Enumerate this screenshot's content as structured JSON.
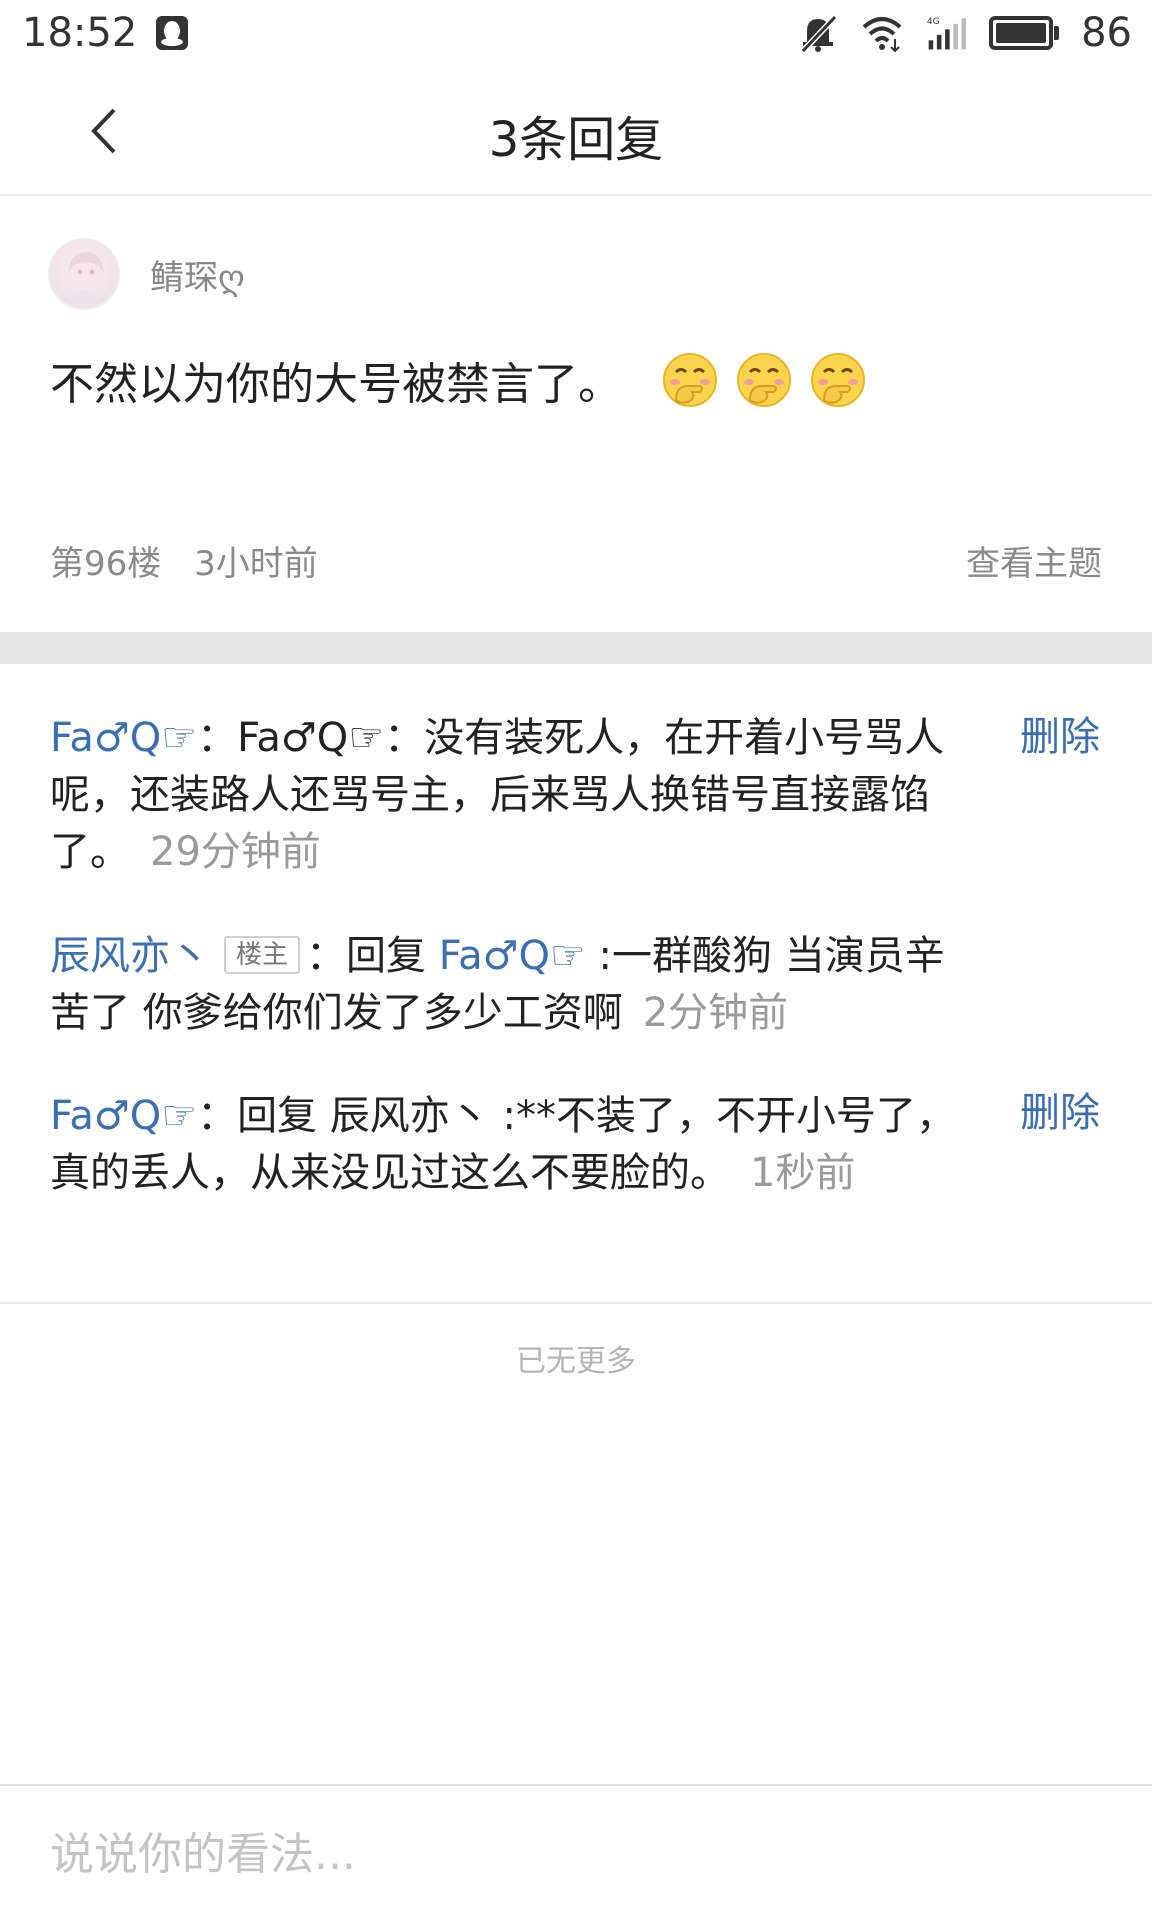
{
  "status_bar": {
    "time": "18:52",
    "battery": "86",
    "icons": [
      "qq-icon",
      "mute-icon",
      "wifi-icon",
      "signal-4g-icon",
      "battery-icon"
    ]
  },
  "header": {
    "title": "3条回复"
  },
  "post": {
    "author": "鲭琛ღ",
    "text": "不然以为你的大号被禁言了。",
    "emoji_count": 3,
    "floor": "第96楼",
    "time": "3小时前",
    "view_topic": "查看主题"
  },
  "replies": [
    {
      "user": "Fa♂Q☞",
      "sep": "：",
      "body": "Fa♂Q☞：没有装死人，在开着小号骂人呢，还装路人还骂号主，后来骂人换错号直接露馅了。",
      "time": "29分钟前",
      "delete": "删除"
    },
    {
      "user": "辰风亦丶",
      "badge": "楼主",
      "sep": "：",
      "reply_prefix": "回复 ",
      "reply_to": "Fa♂Q☞",
      "body": " :一群酸狗 当演员辛苦了 你爹给你们发了多少工资啊",
      "time": "2分钟前"
    },
    {
      "user": "Fa♂Q☞",
      "sep": "：",
      "body": "回复 辰风亦丶 :**不装了，不开小号了，真的丢人，从来没见过这么不要脸的。",
      "time": "1秒前",
      "delete": "删除"
    }
  ],
  "footer": {
    "no_more": "已无更多",
    "input_placeholder": "说说你的看法..."
  },
  "colors": {
    "link_blue": "#3b6fb4",
    "meta_gray": "#8a8a8a",
    "divider": "#e6e6e6"
  }
}
